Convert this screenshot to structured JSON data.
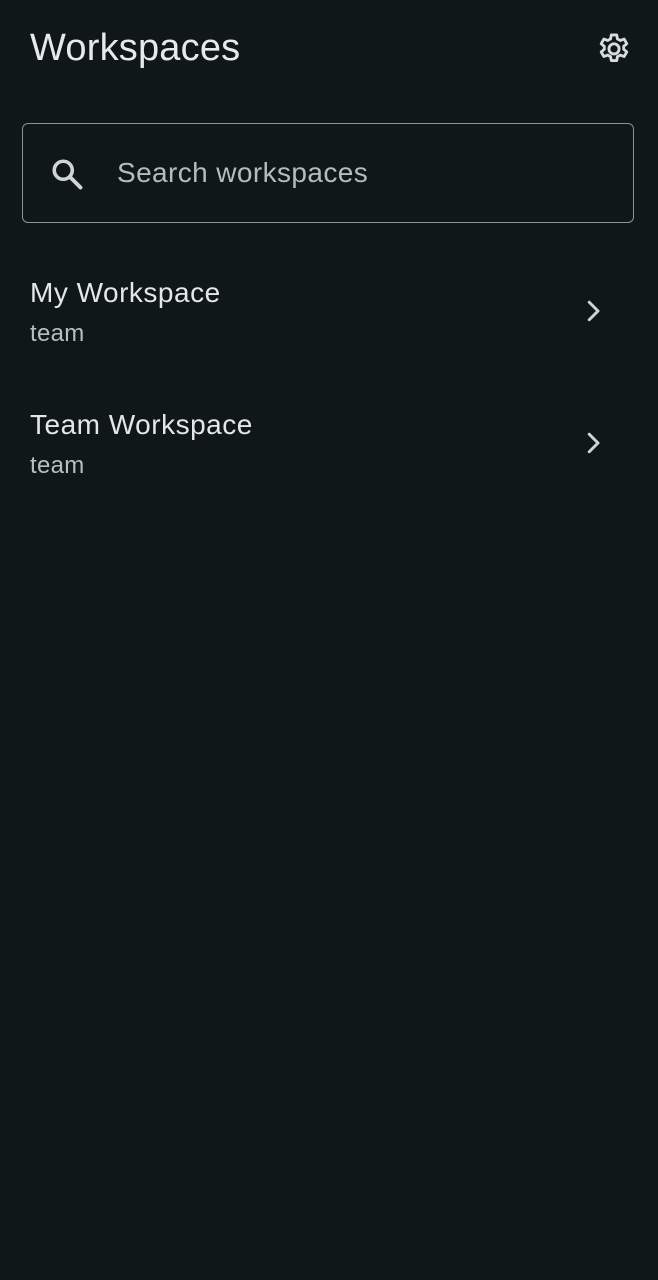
{
  "header": {
    "title": "Workspaces",
    "settings_icon": "gear-icon"
  },
  "search": {
    "placeholder": "Search workspaces",
    "value": "",
    "icon": "search-icon"
  },
  "workspaces": [
    {
      "name": "My Workspace",
      "type": "team",
      "icon": "chevron-right-icon"
    },
    {
      "name": "Team Workspace",
      "type": "team",
      "icon": "chevron-right-icon"
    }
  ],
  "colors": {
    "background": "#0f1717",
    "text_primary": "#e3e7e7",
    "text_secondary": "#b9bfbf",
    "outline": "#8b9494"
  }
}
